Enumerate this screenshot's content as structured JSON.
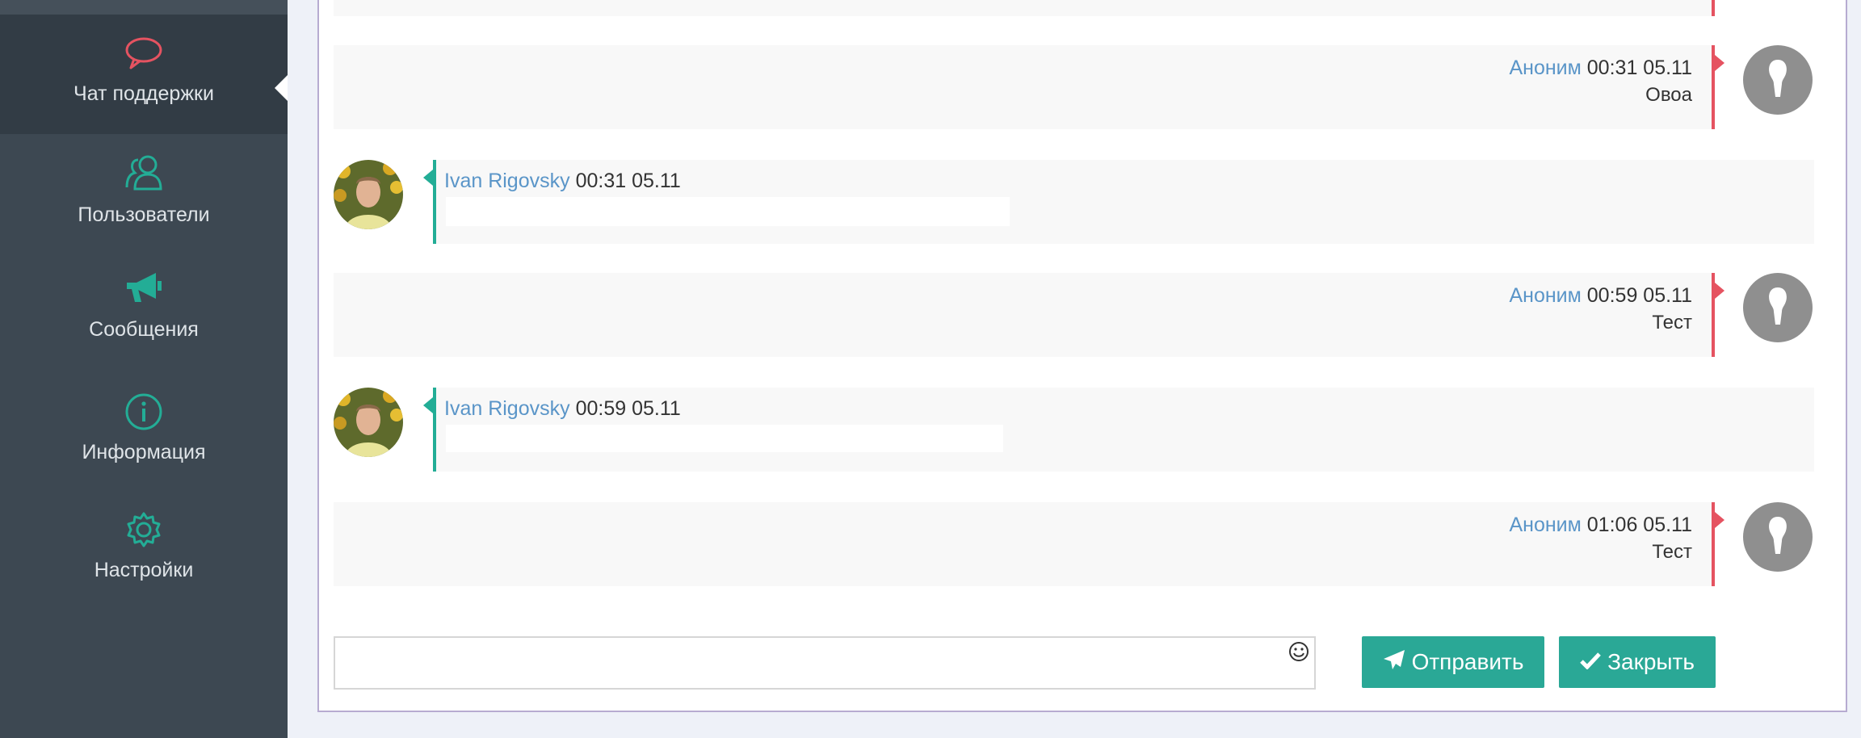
{
  "sidebar": {
    "items": [
      {
        "label": "Чат поддержки",
        "icon": "chat-bubble-icon"
      },
      {
        "label": "Пользователи",
        "icon": "users-icon"
      },
      {
        "label": "Сообщения",
        "icon": "megaphone-icon"
      },
      {
        "label": "Информация",
        "icon": "info-icon"
      },
      {
        "label": "Настройки",
        "icon": "gear-icon"
      }
    ]
  },
  "chat": {
    "messages": [
      {
        "side": "right",
        "author": "Аноним",
        "time": "00:31 05.11",
        "text": "Овоа"
      },
      {
        "side": "left",
        "author": "Ivan Rigovsky",
        "time": "00:31 05.11",
        "text": ""
      },
      {
        "side": "right",
        "author": "Аноним",
        "time": "00:59 05.11",
        "text": "Тест"
      },
      {
        "side": "left",
        "author": "Ivan Rigovsky",
        "time": "00:59 05.11",
        "text": ""
      },
      {
        "side": "right",
        "author": "Аноним",
        "time": "01:06 05.11",
        "text": "Тест"
      }
    ]
  },
  "composer": {
    "placeholder": "",
    "emoji_icon": "smiley-icon",
    "send_label": "Отправить",
    "close_label": "Закрыть"
  },
  "colors": {
    "sidebar_bg": "#3d4852",
    "accent_green": "#2aa896",
    "accent_red": "#e55361",
    "author_blue": "#5a95c8"
  }
}
